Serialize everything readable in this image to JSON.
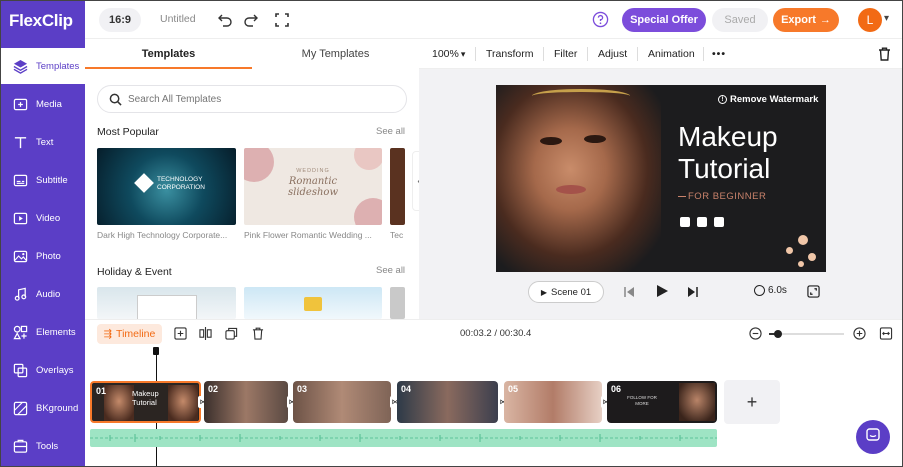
{
  "app": {
    "logo_text_1": "Flex",
    "logo_text_2": "Clip"
  },
  "topbar": {
    "aspect_ratio": "16:9",
    "project_name": "Untitled",
    "special_offer": "Special Offer",
    "saved": "Saved",
    "export": "Export",
    "avatar_letter": "L"
  },
  "sidebar": {
    "items": [
      {
        "label": "Templates",
        "icon": "templates-icon"
      },
      {
        "label": "Media",
        "icon": "media-icon"
      },
      {
        "label": "Text",
        "icon": "text-icon"
      },
      {
        "label": "Subtitle",
        "icon": "subtitle-icon"
      },
      {
        "label": "Video",
        "icon": "video-icon"
      },
      {
        "label": "Photo",
        "icon": "photo-icon"
      },
      {
        "label": "Audio",
        "icon": "audio-icon"
      },
      {
        "label": "Elements",
        "icon": "elements-icon"
      },
      {
        "label": "Overlays",
        "icon": "overlays-icon"
      },
      {
        "label": "BKground",
        "icon": "background-icon"
      },
      {
        "label": "Tools",
        "icon": "tools-icon"
      }
    ]
  },
  "templates_panel": {
    "tabs": [
      "Templates",
      "My Templates"
    ],
    "search_placeholder": "Search All Templates",
    "sections": [
      {
        "title": "Most Popular",
        "see_all": "See all",
        "items": [
          {
            "label": "Dark High Technology Corporate...",
            "thumb_title": "TECHNOLOGY CORPORATION"
          },
          {
            "label": "Pink Flower Romantic Wedding ...",
            "thumb_kicker": "WEDDING",
            "thumb_title": "Romantic slideshow"
          },
          {
            "label": "Tec"
          }
        ]
      },
      {
        "title": "Holiday & Event",
        "see_all": "See all"
      }
    ]
  },
  "editor_toolbar": {
    "zoom": "100%",
    "tools": [
      "Transform",
      "Filter",
      "Adjust",
      "Animation"
    ]
  },
  "canvas": {
    "remove_watermark": "Remove Watermark",
    "title_line1": "Makeup",
    "title_line2": "Tutorial",
    "subtitle": "FOR BEGINNER"
  },
  "player": {
    "scene_label": "Scene 01",
    "duration": "6.0s"
  },
  "timeline": {
    "label": "Timeline",
    "time_display": "00:03.2 / 00:30.4",
    "zoom_level": 0.12,
    "clips": [
      {
        "num": "01",
        "title_line1": "Makeup",
        "title_line2": "Tutorial"
      },
      {
        "num": "02"
      },
      {
        "num": "03"
      },
      {
        "num": "04"
      },
      {
        "num": "05"
      },
      {
        "num": "06",
        "caption": "FOLLOW FOR MORE"
      }
    ]
  },
  "colors": {
    "brand_purple": "#5b3ec6",
    "export_orange": "#f7792a",
    "offer_purple": "#7c4ddb",
    "avatar_orange": "#f26a14",
    "waveform_green": "#9ee4c4"
  }
}
